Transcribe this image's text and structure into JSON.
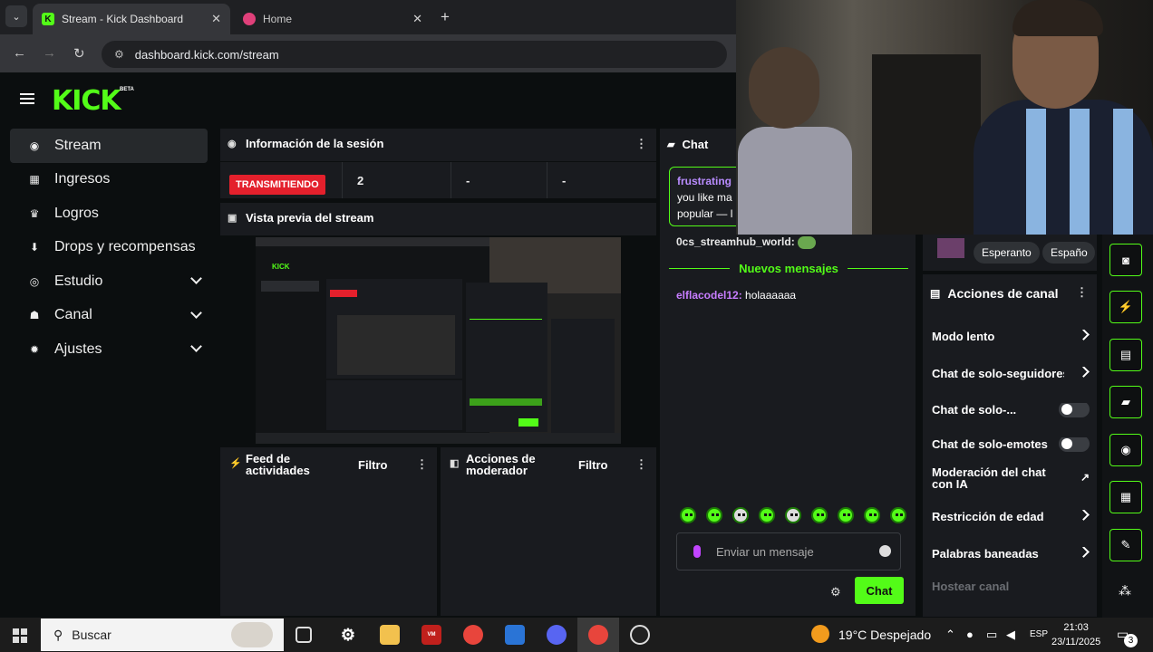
{
  "browser": {
    "tabs": [
      {
        "title": "Stream - Kick Dashboard",
        "active": true
      },
      {
        "title": "Home",
        "active": false
      }
    ],
    "url": "dashboard.kick.com/stream"
  },
  "kick": {
    "logo": "KICK",
    "beta": "BETA",
    "sidebar": [
      {
        "label": "Stream",
        "icon": "broadcast-icon",
        "active": true
      },
      {
        "label": "Ingresos",
        "icon": "chart-icon"
      },
      {
        "label": "Logros",
        "icon": "trophy-icon"
      },
      {
        "label": "Drops y recompensas",
        "icon": "drops-icon"
      },
      {
        "label": "Estudio",
        "icon": "studio-icon",
        "expandable": true
      },
      {
        "label": "Canal",
        "icon": "channel-icon",
        "expandable": true
      },
      {
        "label": "Ajustes",
        "icon": "gear-icon",
        "expandable": true
      }
    ],
    "session": {
      "title": "Información de la sesión",
      "status": "TRANSMITIENDO",
      "stats": [
        "2",
        "-",
        "-"
      ]
    },
    "preview": {
      "title": "Vista previa del stream"
    },
    "feed": {
      "title": "Feed de actividades",
      "filter": "Filtro"
    },
    "mod": {
      "title": "Acciones de moderador",
      "filter": "Filtro"
    },
    "chat": {
      "title": "Chat",
      "pinned_user": "frustrating",
      "pinned_text": "you like ma popular — l",
      "msg1_user": "0cs_streamhub_world:",
      "new_label": "Nuevos mensajes",
      "msg2_user": "elflacodel12:",
      "msg2_text": "holaaaaaa",
      "placeholder": "Enviar un mensaje",
      "send": "Chat"
    },
    "tags": [
      "Esperanto",
      "Españo"
    ],
    "actions": {
      "title": "Acciones de canal",
      "rows": [
        {
          "label": "Modo lento",
          "type": "arrow"
        },
        {
          "label": "Chat de solo-seguidores",
          "type": "arrow"
        },
        {
          "label": "Chat de solo-...",
          "type": "toggle"
        },
        {
          "label": "Chat de solo-emotes",
          "type": "toggle"
        },
        {
          "label": "Moderación del chat con IA",
          "type": "external"
        },
        {
          "label": "Restricción de edad",
          "type": "arrow"
        },
        {
          "label": "Palabras baneadas",
          "type": "arrow"
        },
        {
          "label": "Hostear canal",
          "type": "disabled"
        }
      ]
    }
  },
  "taskbar": {
    "search_placeholder": "Buscar",
    "weather": "19°C Despejado",
    "lang": "ESP",
    "time": "21:03",
    "date": "23/11/2025",
    "notif": "3"
  },
  "colors": {
    "accent": "#53fc18",
    "live": "#e4202c",
    "panel": "#191b1f"
  }
}
